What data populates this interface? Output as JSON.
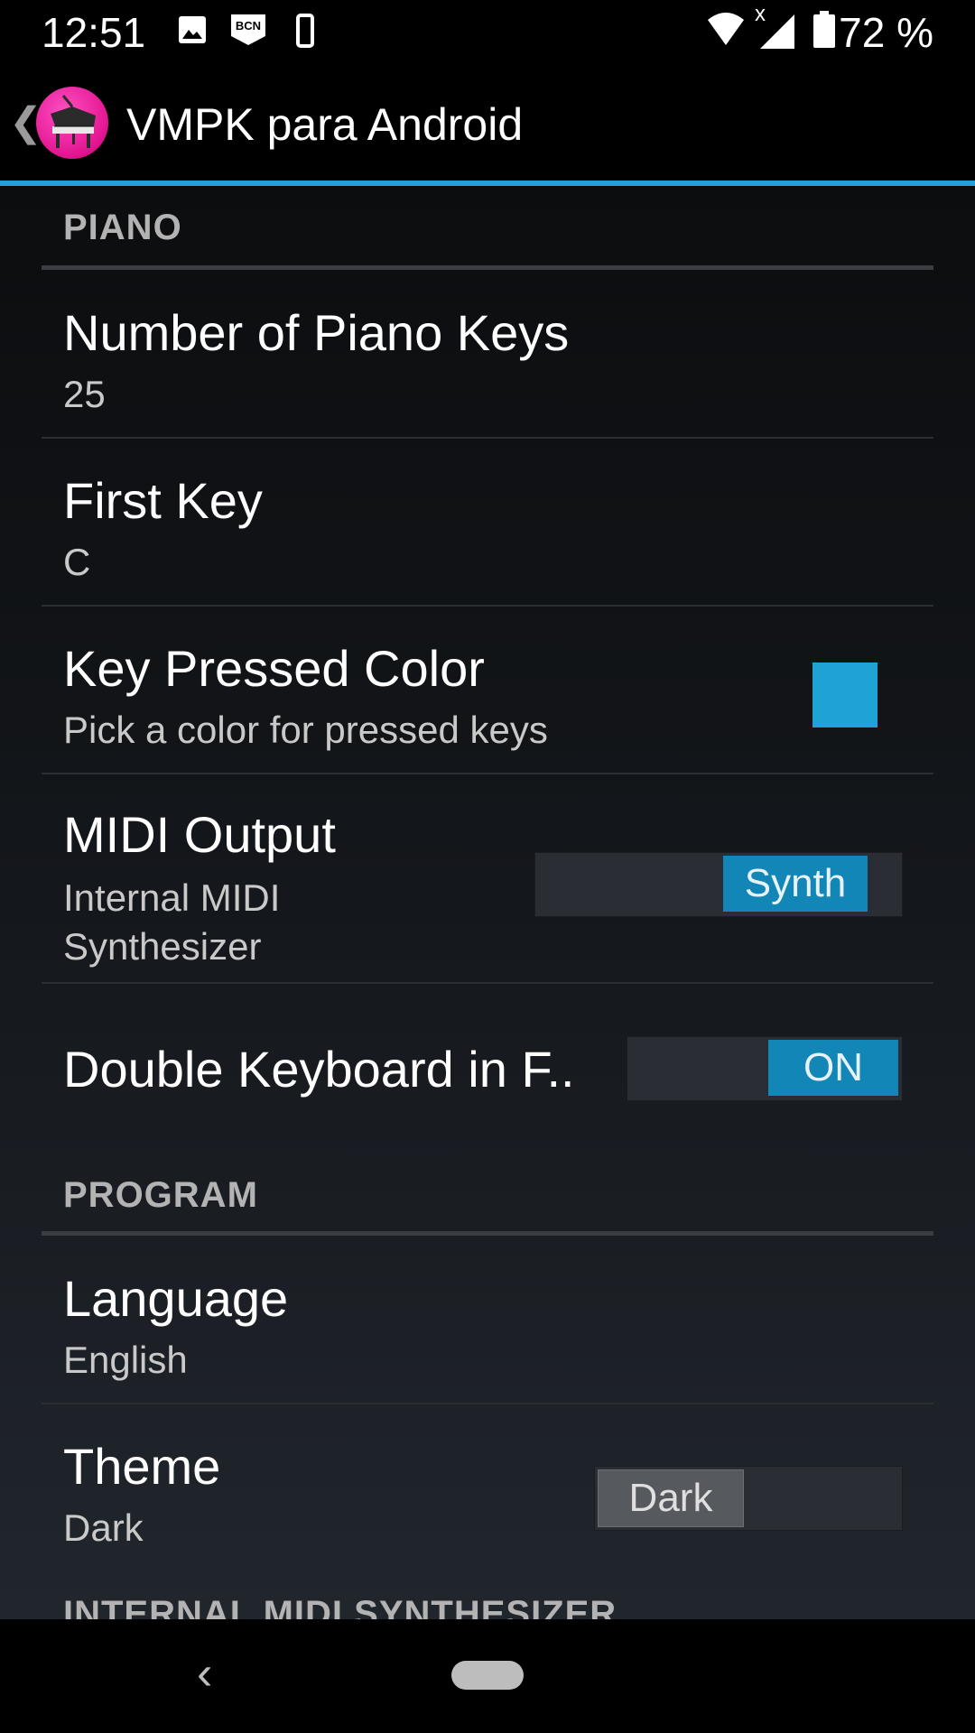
{
  "status_bar": {
    "time": "12:51",
    "icons": [
      "image-icon",
      "bcn-badge-icon",
      "phone-vibrate-icon",
      "wifi-icon",
      "no-signal-icon",
      "battery-icon"
    ],
    "bcn_label": "BCN",
    "signal_x": "x",
    "battery_percent": "72 %"
  },
  "action_bar": {
    "back_glyph": "❮",
    "title": "VMPK para Android",
    "accent_color": "#22a2d2"
  },
  "sections": {
    "piano": {
      "header": "PIANO",
      "items": {
        "num_keys": {
          "title": "Number of Piano Keys",
          "summary": "25"
        },
        "first_key": {
          "title": "First Key",
          "summary": "C"
        },
        "key_color": {
          "title": "Key Pressed Color",
          "summary": "Pick a color for pressed keys",
          "color": "#1fa2d6"
        },
        "midi_output": {
          "title": "MIDI Output",
          "summary_line1": "Internal MIDI",
          "summary_line2": "Synthesizer",
          "toggle_label": "Synth"
        },
        "double_keyboard": {
          "title": "Double Keyboard in F..",
          "toggle_label": "ON"
        }
      }
    },
    "program": {
      "header": "PROGRAM",
      "items": {
        "language": {
          "title": "Language",
          "summary": "English"
        },
        "theme": {
          "title": "Theme",
          "summary": "Dark",
          "toggle_label": "Dark"
        }
      }
    },
    "synth": {
      "header": "INTERNAL MIDI SYNTHESIZER"
    }
  },
  "nav_bar": {
    "back_glyph": "‹"
  }
}
